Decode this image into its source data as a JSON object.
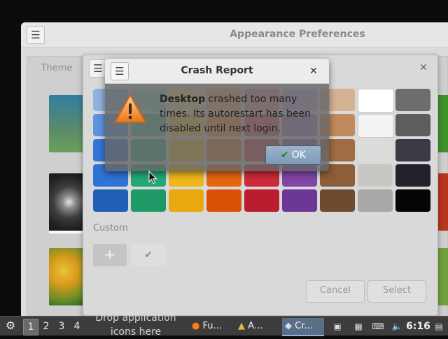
{
  "preferences_window": {
    "title": "Appearance Preferences",
    "menu_icon": "hamburger-icon",
    "tab_label": "Theme",
    "wallpapers": [
      "teal-landscape",
      "galaxy-spiral",
      "yellow-flower"
    ]
  },
  "color_dialog": {
    "menu_icon": "hamburger-icon",
    "close_label": "✕",
    "swatches": [
      [
        "#8fb2e0",
        "#8ecfb0",
        "#f3d97a",
        "#f0a46a",
        "#e38a8f",
        "#c3a2d8",
        "#d4b294",
        "#ffffff",
        "#6d6d6d"
      ],
      [
        "#5c94e0",
        "#47c28f",
        "#f0c440",
        "#f08a30",
        "#e0505b",
        "#a775c8",
        "#c08a5c",
        "#f3f3f3",
        "#5d5d5d"
      ],
      [
        "#3277d8",
        "#2bb07b",
        "#eeb620",
        "#ea6d12",
        "#d43543",
        "#8f55b6",
        "#9f6c43",
        "#dcdcda",
        "#3a3a44"
      ],
      [
        "#2d74d6",
        "#23a873",
        "#efb71a",
        "#e56510",
        "#cc2a39",
        "#8046a8",
        "#8e5e38",
        "#c7c7c4",
        "#22222c"
      ],
      [
        "#1f5fb5",
        "#1f9a67",
        "#e7a90f",
        "#d95208",
        "#ba1d2e",
        "#6c3797",
        "#6e4a2e",
        "#a8a8a6",
        "#050505"
      ]
    ],
    "custom_label": "Custom",
    "add_label": "+",
    "check_label": "✔",
    "cancel_label": "Cancel",
    "select_label": "Select"
  },
  "crash_dialog": {
    "title": "Crash Report",
    "menu_icon": "hamburger-icon",
    "close_label": "✕",
    "message_bold": "Desktop",
    "message_rest": " crashed too many times. Its autorestart has been disabled until next login.",
    "ok_label": "OK",
    "warning_icon": "warning-triangle-icon"
  },
  "taskbar": {
    "start_icon": "menu-logo-icon",
    "workspaces": [
      "1",
      "2",
      "3",
      "4"
    ],
    "drop_hint": "Drop application icons here",
    "tasks": [
      {
        "label": "Fu...",
        "icon": "firefox-icon"
      },
      {
        "label": "A...",
        "icon": "appearance-icon"
      },
      {
        "label": "Cr...",
        "icon": "crash-icon"
      }
    ],
    "clock": "6:16"
  }
}
